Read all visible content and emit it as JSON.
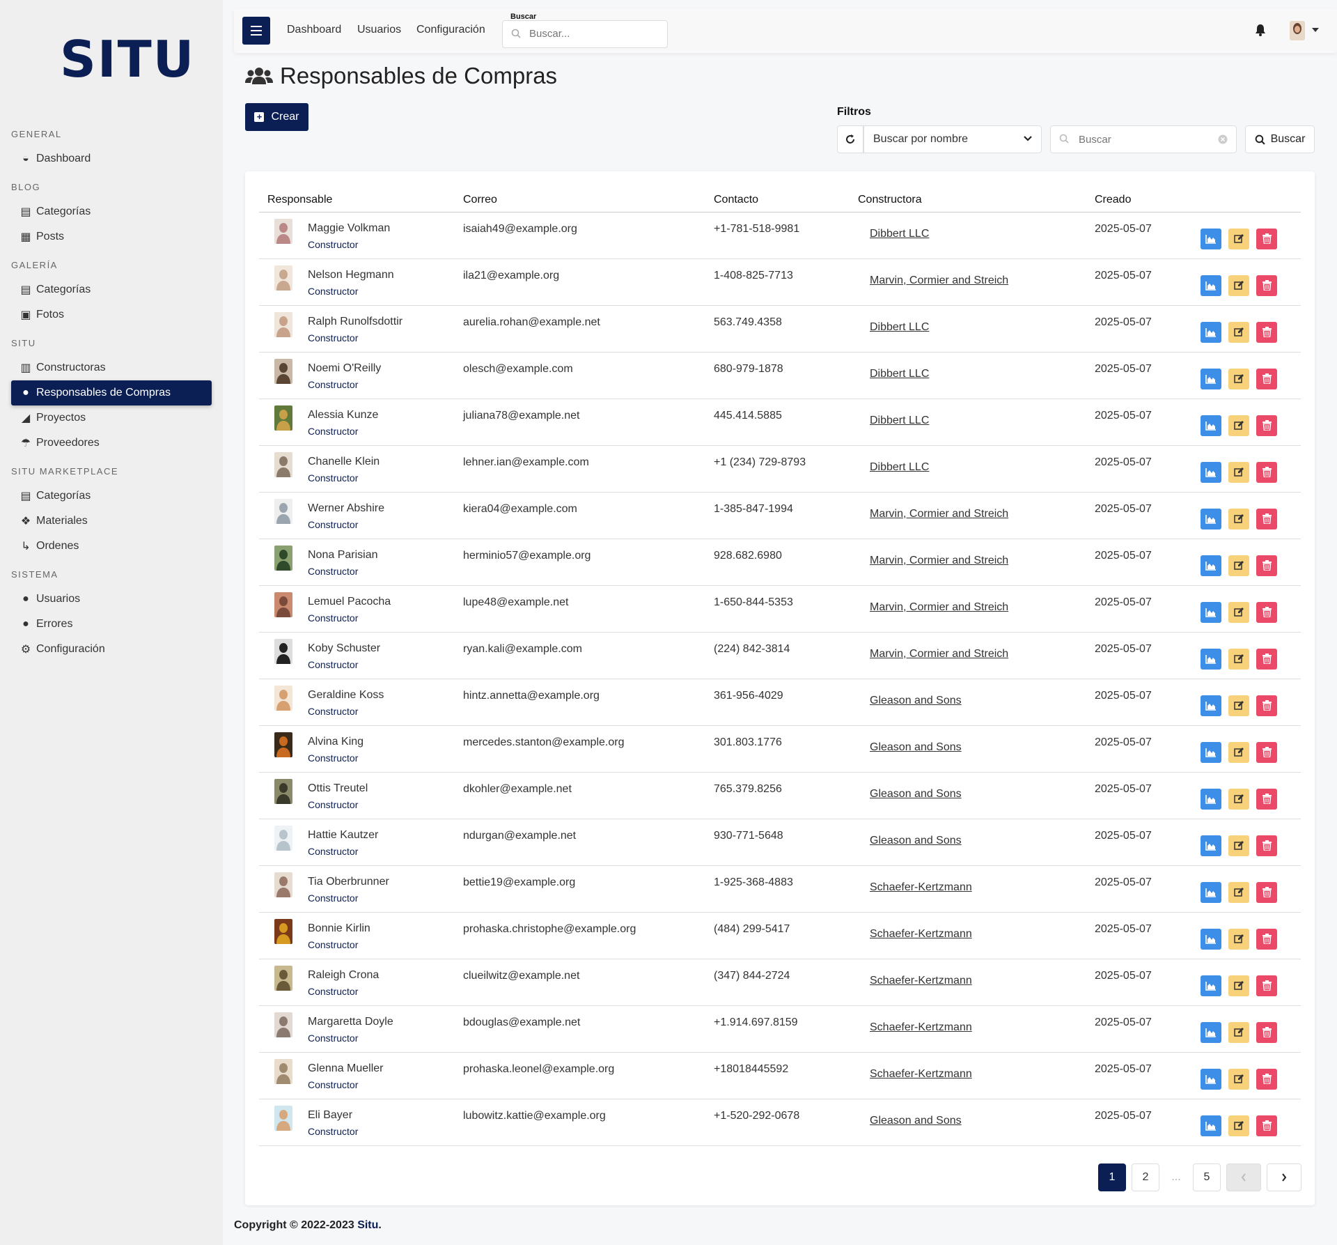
{
  "brand": {
    "logo": "SITU",
    "color": "#0c1f55"
  },
  "sidebar": {
    "sections": [
      {
        "title": "GENERAL",
        "items": [
          {
            "label": "Dashboard",
            "icon": "palette-icon",
            "glyph": "◒"
          }
        ]
      },
      {
        "title": "BLOG",
        "items": [
          {
            "label": "Categorías",
            "icon": "archive-icon",
            "glyph": "▤"
          },
          {
            "label": "Posts",
            "icon": "newspaper-icon",
            "glyph": "▦"
          }
        ]
      },
      {
        "title": "GALERÍA",
        "items": [
          {
            "label": "Categorías",
            "icon": "archive-icon",
            "glyph": "▤"
          },
          {
            "label": "Fotos",
            "icon": "images-icon",
            "glyph": "▣"
          }
        ]
      },
      {
        "title": "SITU",
        "items": [
          {
            "label": "Constructoras",
            "icon": "building-icon",
            "glyph": "▥"
          },
          {
            "label": "Responsables de Compras",
            "icon": "users-icon",
            "glyph": "●",
            "active": true
          },
          {
            "label": "Proyectos",
            "icon": "chart-area-icon",
            "glyph": "◢"
          },
          {
            "label": "Proveedores",
            "icon": "parachute-icon",
            "glyph": "☂"
          }
        ]
      },
      {
        "title": "SITU MARKETPLACE",
        "items": [
          {
            "label": "Categorías",
            "icon": "archive-icon",
            "glyph": "▤"
          },
          {
            "label": "Materiales",
            "icon": "cubes-icon",
            "glyph": "❖"
          },
          {
            "label": "Ordenes",
            "icon": "dolly-icon",
            "glyph": "↳"
          }
        ]
      },
      {
        "title": "SISTEMA",
        "items": [
          {
            "label": "Usuarios",
            "icon": "users-icon",
            "glyph": "●"
          },
          {
            "label": "Errores",
            "icon": "bomb-icon",
            "glyph": "●"
          },
          {
            "label": "Configuración",
            "icon": "cogs-icon",
            "glyph": "⚙"
          }
        ]
      }
    ]
  },
  "topbar": {
    "links": [
      "Dashboard",
      "Usuarios",
      "Configuración"
    ],
    "search_label": "Buscar",
    "search_placeholder": "Buscar..."
  },
  "page": {
    "title": "Responsables de Compras",
    "create_label": "Crear",
    "filters_label": "Filtros",
    "filter_select_value": "Buscar por nombre",
    "filter_search_placeholder": "Buscar",
    "search_button_label": "Buscar"
  },
  "table": {
    "headers": [
      "Responsable",
      "Correo",
      "Contacto",
      "Constructora",
      "Creado"
    ],
    "rows": [
      {
        "name": "Maggie Volkman",
        "role": "Constructor",
        "email": "isaiah49@example.org",
        "contact": "+1-781-518-9981",
        "company": "Dibbert LLC",
        "created": "2025-05-07",
        "thumb": [
          "#b88",
          "#e8e0d8"
        ]
      },
      {
        "name": "Nelson Hegmann",
        "role": "Constructor",
        "email": "ila21@example.org",
        "contact": "1-408-825-7713",
        "company": "Marvin, Cormier and Streich",
        "created": "2025-05-07",
        "thumb": [
          "#c9a890",
          "#f0e6dc"
        ]
      },
      {
        "name": "Ralph Runolfsdottir",
        "role": "Constructor",
        "email": "aurelia.rohan@example.net",
        "contact": "563.749.4358",
        "company": "Dibbert LLC",
        "created": "2025-05-07",
        "thumb": [
          "#c8a28a",
          "#efe5da"
        ]
      },
      {
        "name": "Noemi O'Reilly",
        "role": "Constructor",
        "email": "olesch@example.com",
        "contact": "680-979-1878",
        "company": "Dibbert LLC",
        "created": "2025-05-07",
        "thumb": [
          "#5a4535",
          "#c9b8a5"
        ]
      },
      {
        "name": "Alessia Kunze",
        "role": "Constructor",
        "email": "juliana78@example.net",
        "contact": "445.414.5885",
        "company": "Dibbert LLC",
        "created": "2025-05-07",
        "thumb": [
          "#c9a04a",
          "#5f7a3a"
        ]
      },
      {
        "name": "Chanelle Klein",
        "role": "Constructor",
        "email": "lehner.ian@example.com",
        "contact": "+1 (234) 729-8793",
        "company": "Dibbert LLC",
        "created": "2025-05-07",
        "thumb": [
          "#8a7a6a",
          "#e5ddd0"
        ]
      },
      {
        "name": "Werner Abshire",
        "role": "Constructor",
        "email": "kiera04@example.com",
        "contact": "1-385-847-1994",
        "company": "Marvin, Cormier and Streich",
        "created": "2025-05-07",
        "thumb": [
          "#9aa5b0",
          "#eeeeee"
        ]
      },
      {
        "name": "Nona Parisian",
        "role": "Constructor",
        "email": "herminio57@example.org",
        "contact": "928.682.6980",
        "company": "Marvin, Cormier and Streich",
        "created": "2025-05-07",
        "thumb": [
          "#2f4a2a",
          "#8aa070"
        ]
      },
      {
        "name": "Lemuel Pacocha",
        "role": "Constructor",
        "email": "lupe48@example.net",
        "contact": "1-650-844-5353",
        "company": "Marvin, Cormier and Streich",
        "created": "2025-05-07",
        "thumb": [
          "#7a4a3a",
          "#c98a70"
        ]
      },
      {
        "name": "Koby Schuster",
        "role": "Constructor",
        "email": "ryan.kali@example.com",
        "contact": "(224) 842-3814",
        "company": "Marvin, Cormier and Streich",
        "created": "2025-05-07",
        "thumb": [
          "#222222",
          "#dddddd"
        ]
      },
      {
        "name": "Geraldine Koss",
        "role": "Constructor",
        "email": "hintz.annetta@example.org",
        "contact": "361-956-4029",
        "company": "Gleason and Sons",
        "created": "2025-05-07",
        "thumb": [
          "#d7a070",
          "#f3e6d6"
        ]
      },
      {
        "name": "Alvina King",
        "role": "Constructor",
        "email": "mercedes.stanton@example.org",
        "contact": "301.803.1776",
        "company": "Gleason and Sons",
        "created": "2025-05-07",
        "thumb": [
          "#c86a20",
          "#3a2a1a"
        ]
      },
      {
        "name": "Ottis Treutel",
        "role": "Constructor",
        "email": "dkohler@example.net",
        "contact": "765.379.8256",
        "company": "Gleason and Sons",
        "created": "2025-05-07",
        "thumb": [
          "#3a3a2a",
          "#8a8a6a"
        ]
      },
      {
        "name": "Hattie Kautzer",
        "role": "Constructor",
        "email": "ndurgan@example.net",
        "contact": "930-771-5648",
        "company": "Gleason and Sons",
        "created": "2025-05-07",
        "thumb": [
          "#b8c4cc",
          "#eef2f4"
        ]
      },
      {
        "name": "Tia Oberbrunner",
        "role": "Constructor",
        "email": "bettie19@example.org",
        "contact": "1-925-368-4883",
        "company": "Schaefer-Kertzmann",
        "created": "2025-05-07",
        "thumb": [
          "#9a7a6a",
          "#e6dcd2"
        ]
      },
      {
        "name": "Bonnie Kirlin",
        "role": "Constructor",
        "email": "prohaska.christophe@example.org",
        "contact": "(484) 299-5417",
        "company": "Schaefer-Kertzmann",
        "created": "2025-05-07",
        "thumb": [
          "#d69a20",
          "#7a3a1a"
        ]
      },
      {
        "name": "Raleigh Crona",
        "role": "Constructor",
        "email": "clueilwitz@example.net",
        "contact": "(347) 844-2724",
        "company": "Schaefer-Kertzmann",
        "created": "2025-05-07",
        "thumb": [
          "#6a5a3a",
          "#c8b890"
        ]
      },
      {
        "name": "Margaretta Doyle",
        "role": "Constructor",
        "email": "bdouglas@example.net",
        "contact": "+1.914.697.8159",
        "company": "Schaefer-Kertzmann",
        "created": "2025-05-07",
        "thumb": [
          "#8a7a70",
          "#e2dad2"
        ]
      },
      {
        "name": "Glenna Mueller",
        "role": "Constructor",
        "email": "prohaska.leonel@example.org",
        "contact": "+18018445592",
        "company": "Schaefer-Kertzmann",
        "created": "2025-05-07",
        "thumb": [
          "#a08a70",
          "#e8dccc"
        ]
      },
      {
        "name": "Eli Bayer",
        "role": "Constructor",
        "email": "lubowitz.kattie@example.org",
        "contact": "+1-520-292-0678",
        "company": "Gleason and Sons",
        "created": "2025-05-07",
        "thumb": [
          "#d6a880",
          "#cfe6ee"
        ]
      }
    ]
  },
  "pagination": {
    "pages": [
      "1",
      "2",
      "...",
      "5"
    ],
    "current": "1"
  },
  "footer": {
    "prefix": "Copyright © 2022-2023 ",
    "brand": "Situ",
    "suffix": "."
  },
  "colors": {
    "primary": "#0c1f55",
    "view": "#3d8ee6",
    "edit": "#f7d27a",
    "delete": "#ea4a67"
  }
}
